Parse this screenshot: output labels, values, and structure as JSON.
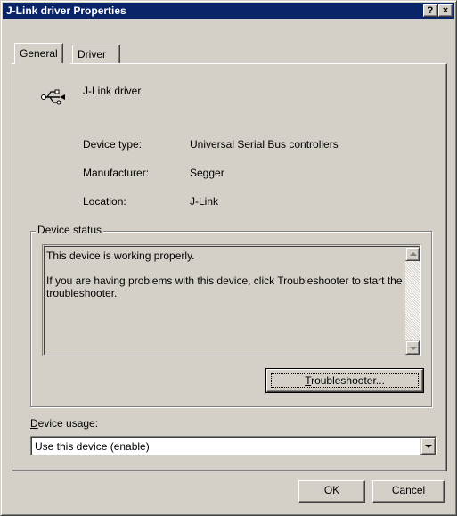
{
  "window": {
    "title": "J-Link driver Properties",
    "help_button": "?",
    "close_button": "×"
  },
  "tabs": [
    {
      "label": "General",
      "active": true
    },
    {
      "label": "Driver",
      "active": false
    }
  ],
  "device": {
    "icon": "usb-icon",
    "name": "J-Link driver",
    "properties": [
      {
        "label": "Device type:",
        "value": "Universal Serial Bus controllers"
      },
      {
        "label": "Manufacturer:",
        "value": "Segger"
      },
      {
        "label": "Location:",
        "value": "J-Link"
      }
    ]
  },
  "device_status": {
    "group_label": "Device status",
    "line1": "This device is working properly.",
    "line2": "If you are having problems with this device, click Troubleshooter to start the troubleshooter.",
    "troubleshooter_button": {
      "mnemonic": "T",
      "rest": "roubleshooter..."
    }
  },
  "device_usage": {
    "label_mnemonic": "D",
    "label_rest": "evice usage:",
    "selected": "Use this device (enable)"
  },
  "footer": {
    "ok_label": "OK",
    "cancel_label": "Cancel"
  },
  "colors": {
    "titlebar": "#0a246a",
    "face": "#d4d0c8"
  }
}
